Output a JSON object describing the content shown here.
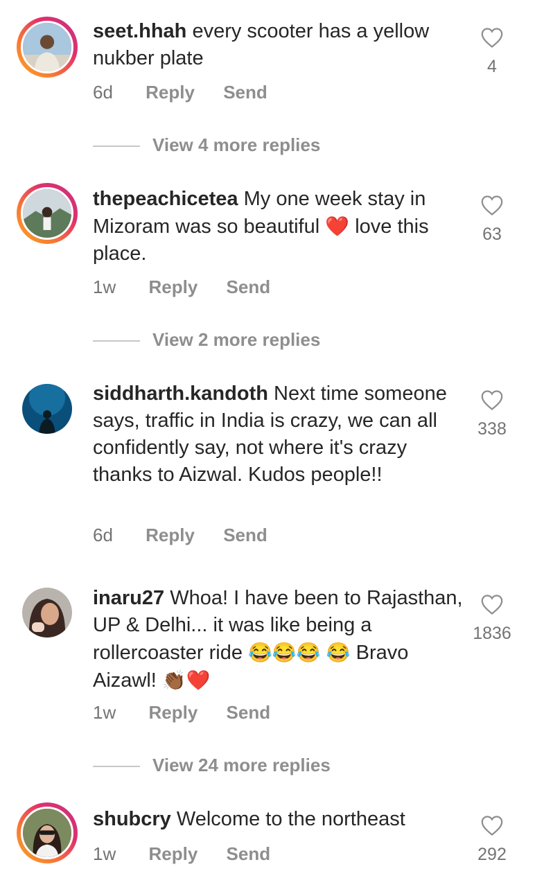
{
  "comments": [
    {
      "username": "seet.hhah",
      "text": "every scooter has a yellow nukber plate",
      "time": "6d",
      "reply_label": "Reply",
      "send_label": "Send",
      "likes": "4",
      "view_replies": "View 4 more replies"
    },
    {
      "username": "thepeachicetea",
      "text_a": "My one week stay in Mizoram was so beautiful",
      "emoji_a": "❤️",
      "text_b": "love this place.",
      "time": "1w",
      "reply_label": "Reply",
      "send_label": "Send",
      "likes": "63",
      "view_replies": "View 2 more replies"
    },
    {
      "username": "siddharth.kandoth",
      "text": "Next time someone says, traffic in India is crazy, we can all confidently say, not where it's crazy thanks to Aizwal. Kudos people!!",
      "time": "6d",
      "reply_label": "Reply",
      "send_label": "Send",
      "likes": "338"
    },
    {
      "username": "inaru27",
      "text_a": "Whoa! I have been to Rajasthan, UP & Delhi... it was like being a rollercoaster ride",
      "emoji_a": "😂😂😂",
      "emoji_b": "😂",
      "text_b": "Bravo Aizawl!",
      "emoji_c": "👏🏾❤️",
      "time": "1w",
      "reply_label": "Reply",
      "send_label": "Send",
      "likes": "1836",
      "view_replies": "View 24 more replies"
    },
    {
      "username": "shubcry",
      "text": "Welcome to the northeast",
      "time": "1w",
      "reply_label": "Reply",
      "send_label": "Send",
      "likes": "292"
    }
  ],
  "colors": {
    "text": "#262626",
    "muted": "#8e8e8e",
    "story_ring_start": "#f9a825",
    "story_ring_end": "#c13584"
  }
}
